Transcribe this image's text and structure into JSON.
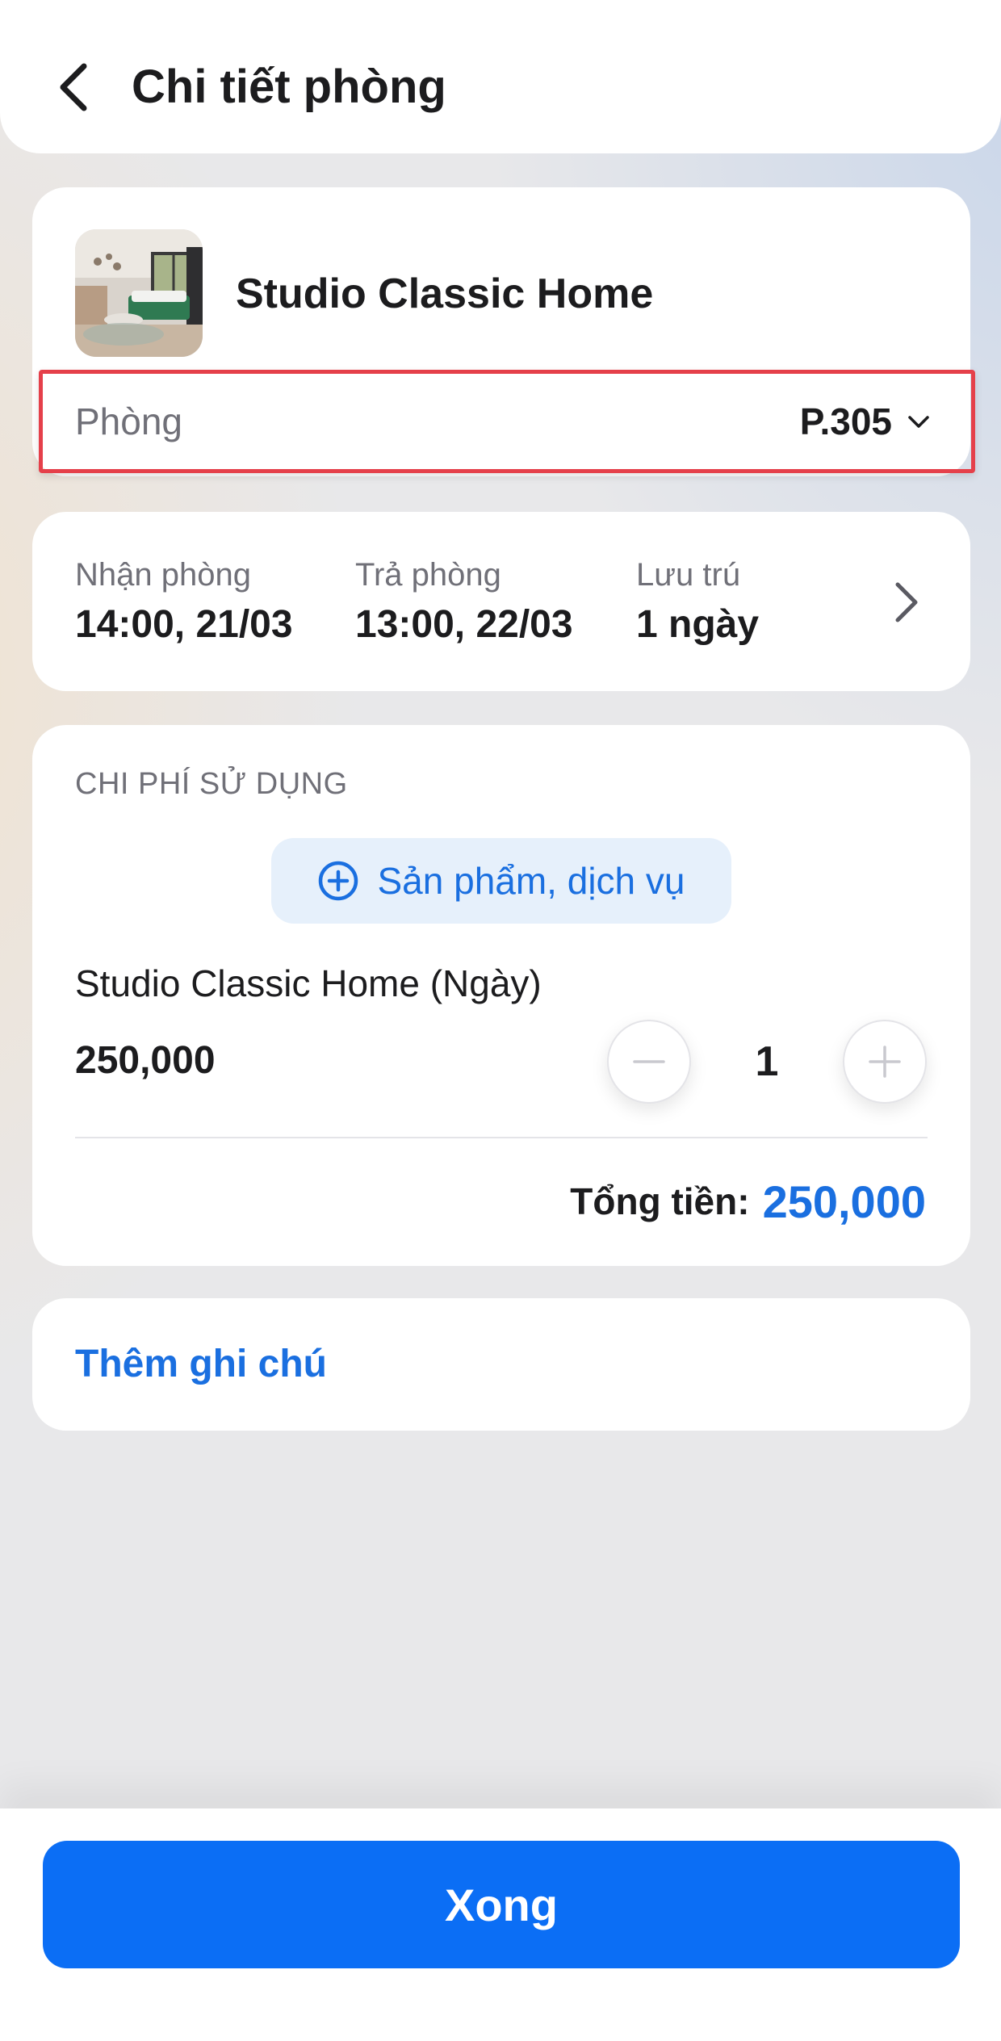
{
  "header": {
    "title": "Chi tiết phòng",
    "back_icon": "chevron-left-icon"
  },
  "room": {
    "name": "Studio Classic Home",
    "room_label": "Phòng",
    "room_value": "P.305",
    "dropdown_icon": "chevron-down-icon"
  },
  "stay": {
    "checkin_label": "Nhận phòng",
    "checkin_value": "14:00, 21/03",
    "checkout_label": "Trả phòng",
    "checkout_value": "13:00, 22/03",
    "duration_label": "Lưu trú",
    "duration_value": "1 ngày",
    "arrow_icon": "chevron-right-icon"
  },
  "costs": {
    "section_title": "CHI PHÍ SỬ DỤNG",
    "add_service_label": "Sản phẩm, dịch vụ",
    "add_service_icon": "plus-circle-icon",
    "items": [
      {
        "name": "Studio Classic Home (Ngày)",
        "price": "250,000",
        "quantity": "1"
      }
    ],
    "total_label": "Tổng tiền:",
    "total_value": "250,000"
  },
  "note": {
    "add_note_label": "Thêm ghi chú"
  },
  "footer": {
    "done_label": "Xong"
  },
  "colors": {
    "accent": "#0b6ef5",
    "link": "#1a6fe0",
    "highlight_border": "#e5404a",
    "muted_text": "#707078"
  }
}
